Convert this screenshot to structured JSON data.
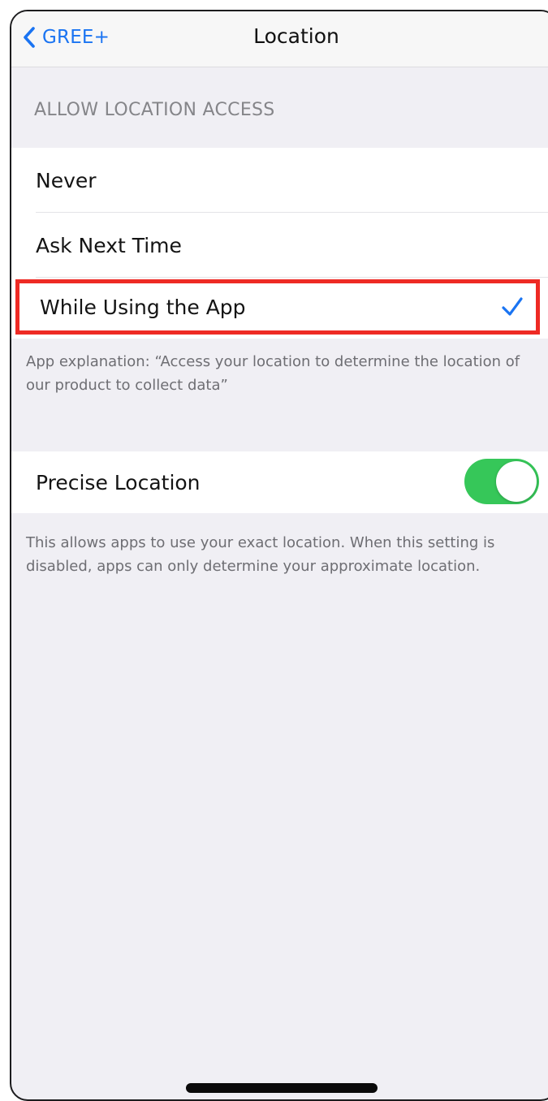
{
  "navbar": {
    "back_label": "GREE+",
    "title": "Location"
  },
  "access_section": {
    "header": "ALLOW LOCATION ACCESS",
    "options": [
      {
        "label": "Never",
        "selected": false
      },
      {
        "label": "Ask Next Time",
        "selected": false
      },
      {
        "label": "While Using the App",
        "selected": true
      }
    ],
    "explanation": "App explanation: “Access your location to determine the location of our product to collect data”"
  },
  "precise_section": {
    "label": "Precise Location",
    "enabled": true,
    "description": "This allows apps to use your exact location. When this setting is disabled, apps can only determine your approximate location."
  },
  "colors": {
    "accent": "#1a74f2",
    "toggle_on": "#36c759",
    "highlight_border": "#ee2a24",
    "background": "#f0eff4"
  },
  "icons": {
    "back": "chevron-left-icon",
    "selected": "checkmark-icon"
  }
}
